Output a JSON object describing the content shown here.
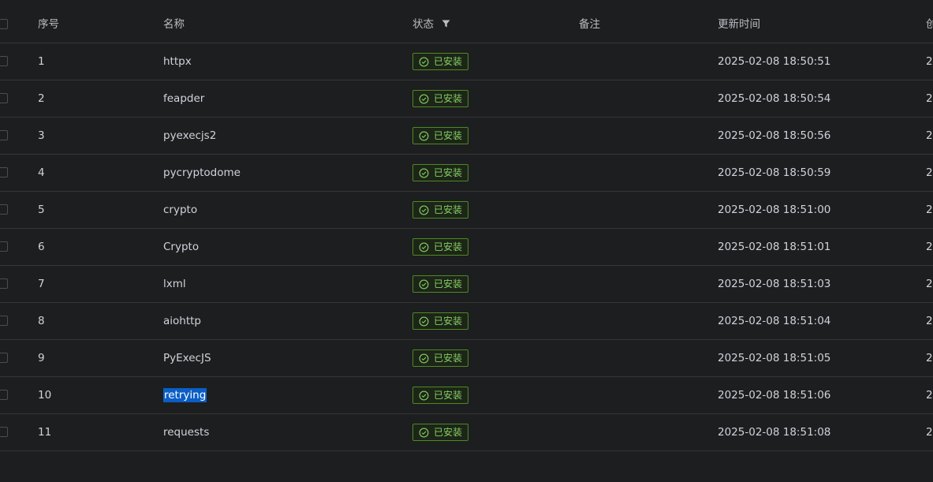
{
  "header": {
    "index": "序号",
    "name": "名称",
    "status": "状态",
    "remark": "备注",
    "updated": "更新时间",
    "created": "创"
  },
  "status_icon": "filter-icon",
  "colors": {
    "background": "#1d1e1f",
    "border": "#363637",
    "success_text": "#85ce61",
    "success_border": "#4d8a23",
    "selection": "#0b5ec5"
  },
  "rows": [
    {
      "index": "1",
      "name": "httpx",
      "status": "已安装",
      "updated": "2025-02-08 18:50:51",
      "created": "2"
    },
    {
      "index": "2",
      "name": "feapder",
      "status": "已安装",
      "updated": "2025-02-08 18:50:54",
      "created": "2"
    },
    {
      "index": "3",
      "name": "pyexecjs2",
      "status": "已安装",
      "updated": "2025-02-08 18:50:56",
      "created": "2"
    },
    {
      "index": "4",
      "name": "pycryptodome",
      "status": "已安装",
      "updated": "2025-02-08 18:50:59",
      "created": "2"
    },
    {
      "index": "5",
      "name": "crypto",
      "status": "已安装",
      "updated": "2025-02-08 18:51:00",
      "created": "2"
    },
    {
      "index": "6",
      "name": "Crypto",
      "status": "已安装",
      "updated": "2025-02-08 18:51:01",
      "created": "2"
    },
    {
      "index": "7",
      "name": "lxml",
      "status": "已安装",
      "updated": "2025-02-08 18:51:03",
      "created": "2"
    },
    {
      "index": "8",
      "name": "aiohttp",
      "status": "已安装",
      "updated": "2025-02-08 18:51:04",
      "created": "2"
    },
    {
      "index": "9",
      "name": "PyExecJS",
      "status": "已安装",
      "updated": "2025-02-08 18:51:05",
      "created": "2"
    },
    {
      "index": "10",
      "name": "retrying",
      "status": "已安装",
      "updated": "2025-02-08 18:51:06",
      "created": "2"
    },
    {
      "index": "11",
      "name": "requests",
      "status": "已安装",
      "updated": "2025-02-08 18:51:08",
      "created": "2"
    }
  ]
}
